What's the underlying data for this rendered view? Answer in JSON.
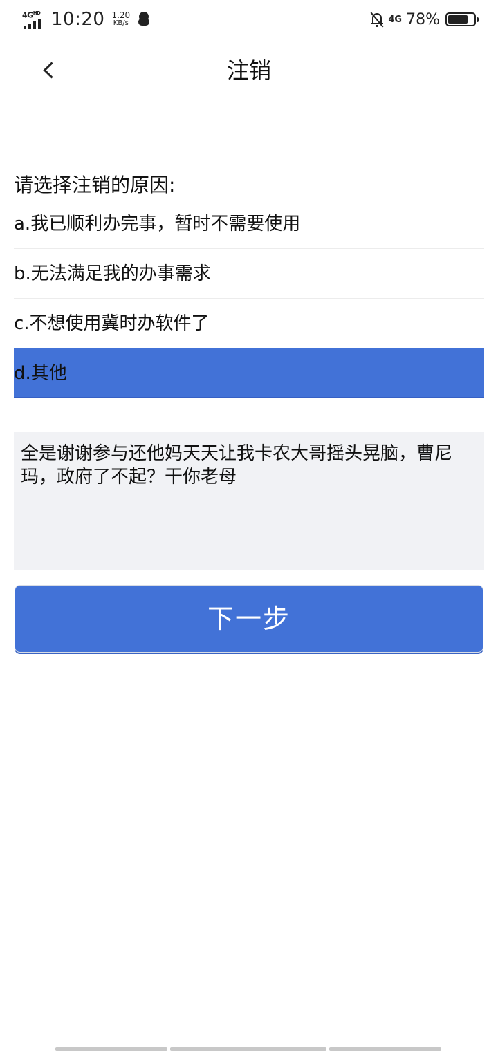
{
  "status_bar": {
    "network_left": "4G",
    "network_left_sup": "HD",
    "time": "10:20",
    "speed_value": "1.20",
    "speed_unit": "KB/s",
    "network_right": "4G",
    "battery_percent": "78%",
    "battery_level": 0.78
  },
  "nav": {
    "title": "注销"
  },
  "form": {
    "prompt": "请选择注销的原因:",
    "options": [
      {
        "label": "a.我已顺利办完事，暂时不需要使用",
        "selected": false
      },
      {
        "label": "b.无法满足我的办事需求",
        "selected": false
      },
      {
        "label": "c.不想使用冀时办软件了",
        "selected": false
      },
      {
        "label": "d.其他",
        "selected": true
      }
    ],
    "reason_text": "全是谢谢参与还他妈天天让我卡农大哥摇头晃脑，曹尼玛，政府了不起？干你老母",
    "next_button_label": "下一步"
  },
  "colors": {
    "accent": "#4272d7",
    "input_bg": "#f1f2f5"
  }
}
